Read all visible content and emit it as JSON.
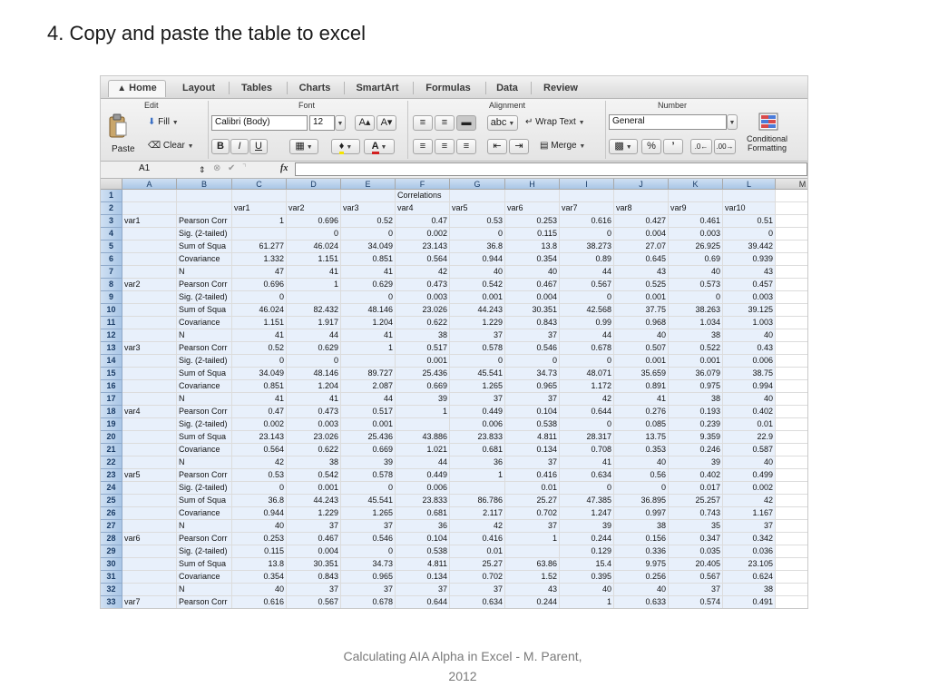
{
  "slide": {
    "title": "4. Copy and paste the table to excel",
    "footer_line1": "Calculating AIA Alpha in Excel - M. Parent,",
    "footer_line2": "2012"
  },
  "ribbon_tabs": [
    "Home",
    "Layout",
    "Tables",
    "Charts",
    "SmartArt",
    "Formulas",
    "Data",
    "Review"
  ],
  "ribbon": {
    "groups": {
      "edit": "Edit",
      "font": "Font",
      "alignment": "Alignment",
      "number": "Number"
    },
    "fill_label": "Fill",
    "clear_label": "Clear",
    "paste_label": "Paste",
    "font_name": "Calibri (Body)",
    "font_size": "12",
    "bold": "B",
    "italic": "I",
    "underline": "U",
    "grow_font": "A▴",
    "shrink_font": "A▾",
    "abc_label": "abc",
    "wrap_text": "Wrap Text",
    "merge": "Merge",
    "number_format": "General",
    "percent": "%",
    "comma": "’",
    "conditional_formatting_1": "Conditional",
    "conditional_formatting_2": "Formatting"
  },
  "formula_bar": {
    "name_box": "A1",
    "fx": "fx",
    "formula": ""
  },
  "sheet": {
    "columns": [
      "A",
      "B",
      "C",
      "D",
      "E",
      "F",
      "G",
      "H",
      "I",
      "J",
      "K",
      "L",
      "M"
    ],
    "rows": [
      {
        "n": "1",
        "c": [
          "",
          "",
          "",
          "",
          "",
          "Correlations",
          "",
          "",
          "",
          "",
          "",
          ""
        ]
      },
      {
        "n": "2",
        "c": [
          "",
          "",
          "var1",
          "var2",
          "var3",
          "var4",
          "var5",
          "var6",
          "var7",
          "var8",
          "var9",
          "var10"
        ]
      },
      {
        "n": "3",
        "c": [
          "var1",
          "Pearson Corr",
          "1",
          "0.696",
          "0.52",
          "0.47",
          "0.53",
          "0.253",
          "0.616",
          "0.427",
          "0.461",
          "0.51"
        ]
      },
      {
        "n": "4",
        "c": [
          "",
          "Sig. (2-tailed)",
          "",
          "0",
          "0",
          "0.002",
          "0",
          "0.115",
          "0",
          "0.004",
          "0.003",
          "0"
        ]
      },
      {
        "n": "5",
        "c": [
          "",
          "Sum of Squa",
          "61.277",
          "46.024",
          "34.049",
          "23.143",
          "36.8",
          "13.8",
          "38.273",
          "27.07",
          "26.925",
          "39.442"
        ]
      },
      {
        "n": "6",
        "c": [
          "",
          "Covariance",
          "1.332",
          "1.151",
          "0.851",
          "0.564",
          "0.944",
          "0.354",
          "0.89",
          "0.645",
          "0.69",
          "0.939"
        ]
      },
      {
        "n": "7",
        "c": [
          "",
          "N",
          "47",
          "41",
          "41",
          "42",
          "40",
          "40",
          "44",
          "43",
          "40",
          "43"
        ]
      },
      {
        "n": "8",
        "c": [
          "var2",
          "Pearson Corr",
          "0.696",
          "1",
          "0.629",
          "0.473",
          "0.542",
          "0.467",
          "0.567",
          "0.525",
          "0.573",
          "0.457"
        ]
      },
      {
        "n": "9",
        "c": [
          "",
          "Sig. (2-tailed)",
          "0",
          "",
          "0",
          "0.003",
          "0.001",
          "0.004",
          "0",
          "0.001",
          "0",
          "0.003"
        ]
      },
      {
        "n": "10",
        "c": [
          "",
          "Sum of Squa",
          "46.024",
          "82.432",
          "48.146",
          "23.026",
          "44.243",
          "30.351",
          "42.568",
          "37.75",
          "38.263",
          "39.125"
        ]
      },
      {
        "n": "11",
        "c": [
          "",
          "Covariance",
          "1.151",
          "1.917",
          "1.204",
          "0.622",
          "1.229",
          "0.843",
          "0.99",
          "0.968",
          "1.034",
          "1.003"
        ]
      },
      {
        "n": "12",
        "c": [
          "",
          "N",
          "41",
          "44",
          "41",
          "38",
          "37",
          "37",
          "44",
          "40",
          "38",
          "40"
        ]
      },
      {
        "n": "13",
        "c": [
          "var3",
          "Pearson Corr",
          "0.52",
          "0.629",
          "1",
          "0.517",
          "0.578",
          "0.546",
          "0.678",
          "0.507",
          "0.522",
          "0.43"
        ]
      },
      {
        "n": "14",
        "c": [
          "",
          "Sig. (2-tailed)",
          "0",
          "0",
          "",
          "0.001",
          "0",
          "0",
          "0",
          "0.001",
          "0.001",
          "0.006"
        ]
      },
      {
        "n": "15",
        "c": [
          "",
          "Sum of Squa",
          "34.049",
          "48.146",
          "89.727",
          "25.436",
          "45.541",
          "34.73",
          "48.071",
          "35.659",
          "36.079",
          "38.75"
        ]
      },
      {
        "n": "16",
        "c": [
          "",
          "Covariance",
          "0.851",
          "1.204",
          "2.087",
          "0.669",
          "1.265",
          "0.965",
          "1.172",
          "0.891",
          "0.975",
          "0.994"
        ]
      },
      {
        "n": "17",
        "c": [
          "",
          "N",
          "41",
          "41",
          "44",
          "39",
          "37",
          "37",
          "42",
          "41",
          "38",
          "40"
        ]
      },
      {
        "n": "18",
        "c": [
          "var4",
          "Pearson Corr",
          "0.47",
          "0.473",
          "0.517",
          "1",
          "0.449",
          "0.104",
          "0.644",
          "0.276",
          "0.193",
          "0.402"
        ]
      },
      {
        "n": "19",
        "c": [
          "",
          "Sig. (2-tailed)",
          "0.002",
          "0.003",
          "0.001",
          "",
          "0.006",
          "0.538",
          "0",
          "0.085",
          "0.239",
          "0.01"
        ]
      },
      {
        "n": "20",
        "c": [
          "",
          "Sum of Squa",
          "23.143",
          "23.026",
          "25.436",
          "43.886",
          "23.833",
          "4.811",
          "28.317",
          "13.75",
          "9.359",
          "22.9"
        ]
      },
      {
        "n": "21",
        "c": [
          "",
          "Covariance",
          "0.564",
          "0.622",
          "0.669",
          "1.021",
          "0.681",
          "0.134",
          "0.708",
          "0.353",
          "0.246",
          "0.587"
        ]
      },
      {
        "n": "22",
        "c": [
          "",
          "N",
          "42",
          "38",
          "39",
          "44",
          "36",
          "37",
          "41",
          "40",
          "39",
          "40"
        ]
      },
      {
        "n": "23",
        "c": [
          "var5",
          "Pearson Corr",
          "0.53",
          "0.542",
          "0.578",
          "0.449",
          "1",
          "0.416",
          "0.634",
          "0.56",
          "0.402",
          "0.499"
        ]
      },
      {
        "n": "24",
        "c": [
          "",
          "Sig. (2-tailed)",
          "0",
          "0.001",
          "0",
          "0.006",
          "",
          "0.01",
          "0",
          "0",
          "0.017",
          "0.002"
        ]
      },
      {
        "n": "25",
        "c": [
          "",
          "Sum of Squa",
          "36.8",
          "44.243",
          "45.541",
          "23.833",
          "86.786",
          "25.27",
          "47.385",
          "36.895",
          "25.257",
          "42"
        ]
      },
      {
        "n": "26",
        "c": [
          "",
          "Covariance",
          "0.944",
          "1.229",
          "1.265",
          "0.681",
          "2.117",
          "0.702",
          "1.247",
          "0.997",
          "0.743",
          "1.167"
        ]
      },
      {
        "n": "27",
        "c": [
          "",
          "N",
          "40",
          "37",
          "37",
          "36",
          "42",
          "37",
          "39",
          "38",
          "35",
          "37"
        ]
      },
      {
        "n": "28",
        "c": [
          "var6",
          "Pearson Corr",
          "0.253",
          "0.467",
          "0.546",
          "0.104",
          "0.416",
          "1",
          "0.244",
          "0.156",
          "0.347",
          "0.342"
        ]
      },
      {
        "n": "29",
        "c": [
          "",
          "Sig. (2-tailed)",
          "0.115",
          "0.004",
          "0",
          "0.538",
          "0.01",
          "",
          "0.129",
          "0.336",
          "0.035",
          "0.036"
        ]
      },
      {
        "n": "30",
        "c": [
          "",
          "Sum of Squa",
          "13.8",
          "30.351",
          "34.73",
          "4.811",
          "25.27",
          "63.86",
          "15.4",
          "9.975",
          "20.405",
          "23.105"
        ]
      },
      {
        "n": "31",
        "c": [
          "",
          "Covariance",
          "0.354",
          "0.843",
          "0.965",
          "0.134",
          "0.702",
          "1.52",
          "0.395",
          "0.256",
          "0.567",
          "0.624"
        ]
      },
      {
        "n": "32",
        "c": [
          "",
          "N",
          "40",
          "37",
          "37",
          "37",
          "37",
          "43",
          "40",
          "40",
          "37",
          "38"
        ]
      },
      {
        "n": "33",
        "c": [
          "var7",
          "Pearson Corr",
          "0.616",
          "0.567",
          "0.678",
          "0.644",
          "0.634",
          "0.244",
          "1",
          "0.633",
          "0.574",
          "0.491"
        ]
      }
    ]
  }
}
